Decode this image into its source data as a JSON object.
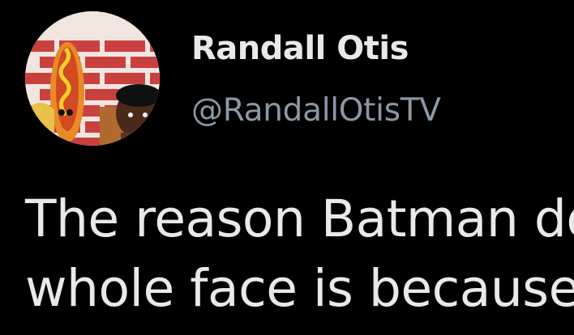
{
  "tweet": {
    "author": {
      "display_name": "Randall Otis",
      "handle": "@RandallOtisTV",
      "avatar_icon": "profile-avatar"
    },
    "text_lines": [
      "The reason Batman do",
      "whole face is because"
    ]
  },
  "colors": {
    "background": "#000000",
    "primary_text": "#e7e9ea",
    "secondary_text": "#8b98a5"
  }
}
